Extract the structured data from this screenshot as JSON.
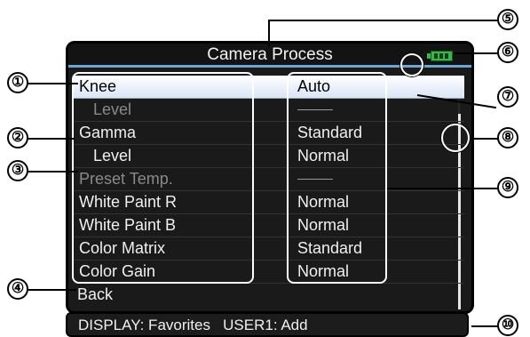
{
  "screen": {
    "title": "Camera Process",
    "battery_icon": "battery-icon",
    "menu_items": [
      {
        "label": "Knee",
        "value": "Auto",
        "selected": true,
        "indent": false,
        "dim": false
      },
      {
        "label": "Level",
        "value": "",
        "selected": false,
        "indent": true,
        "dim": true
      },
      {
        "label": "Gamma",
        "value": "Standard",
        "selected": false,
        "indent": false,
        "dim": false
      },
      {
        "label": "Level",
        "value": "Normal",
        "selected": false,
        "indent": true,
        "dim": false
      },
      {
        "label": "Preset Temp.",
        "value": "",
        "selected": false,
        "indent": false,
        "dim": true
      },
      {
        "label": "White Paint R",
        "value": "Normal",
        "selected": false,
        "indent": false,
        "dim": false
      },
      {
        "label": "White Paint B",
        "value": "Normal",
        "selected": false,
        "indent": false,
        "dim": false
      },
      {
        "label": "Color Matrix",
        "value": "Standard",
        "selected": false,
        "indent": false,
        "dim": false
      },
      {
        "label": "Color Gain",
        "value": "Normal",
        "selected": false,
        "indent": false,
        "dim": false
      },
      {
        "label": "Back",
        "value": "",
        "selected": false,
        "indent": false,
        "dim": false
      }
    ]
  },
  "footer": {
    "text": "DISPLAY: Favorites   USER1: Add"
  },
  "callouts": [
    "①",
    "②",
    "③",
    "④",
    "⑤",
    "⑥",
    "⑦",
    "⑧",
    "⑨",
    "⑩"
  ],
  "colors": {
    "screen_bg": "#1a1a1a",
    "selected_bg": "#ffffff",
    "accent": "#6aa6d8",
    "battery": "#39b54a"
  }
}
